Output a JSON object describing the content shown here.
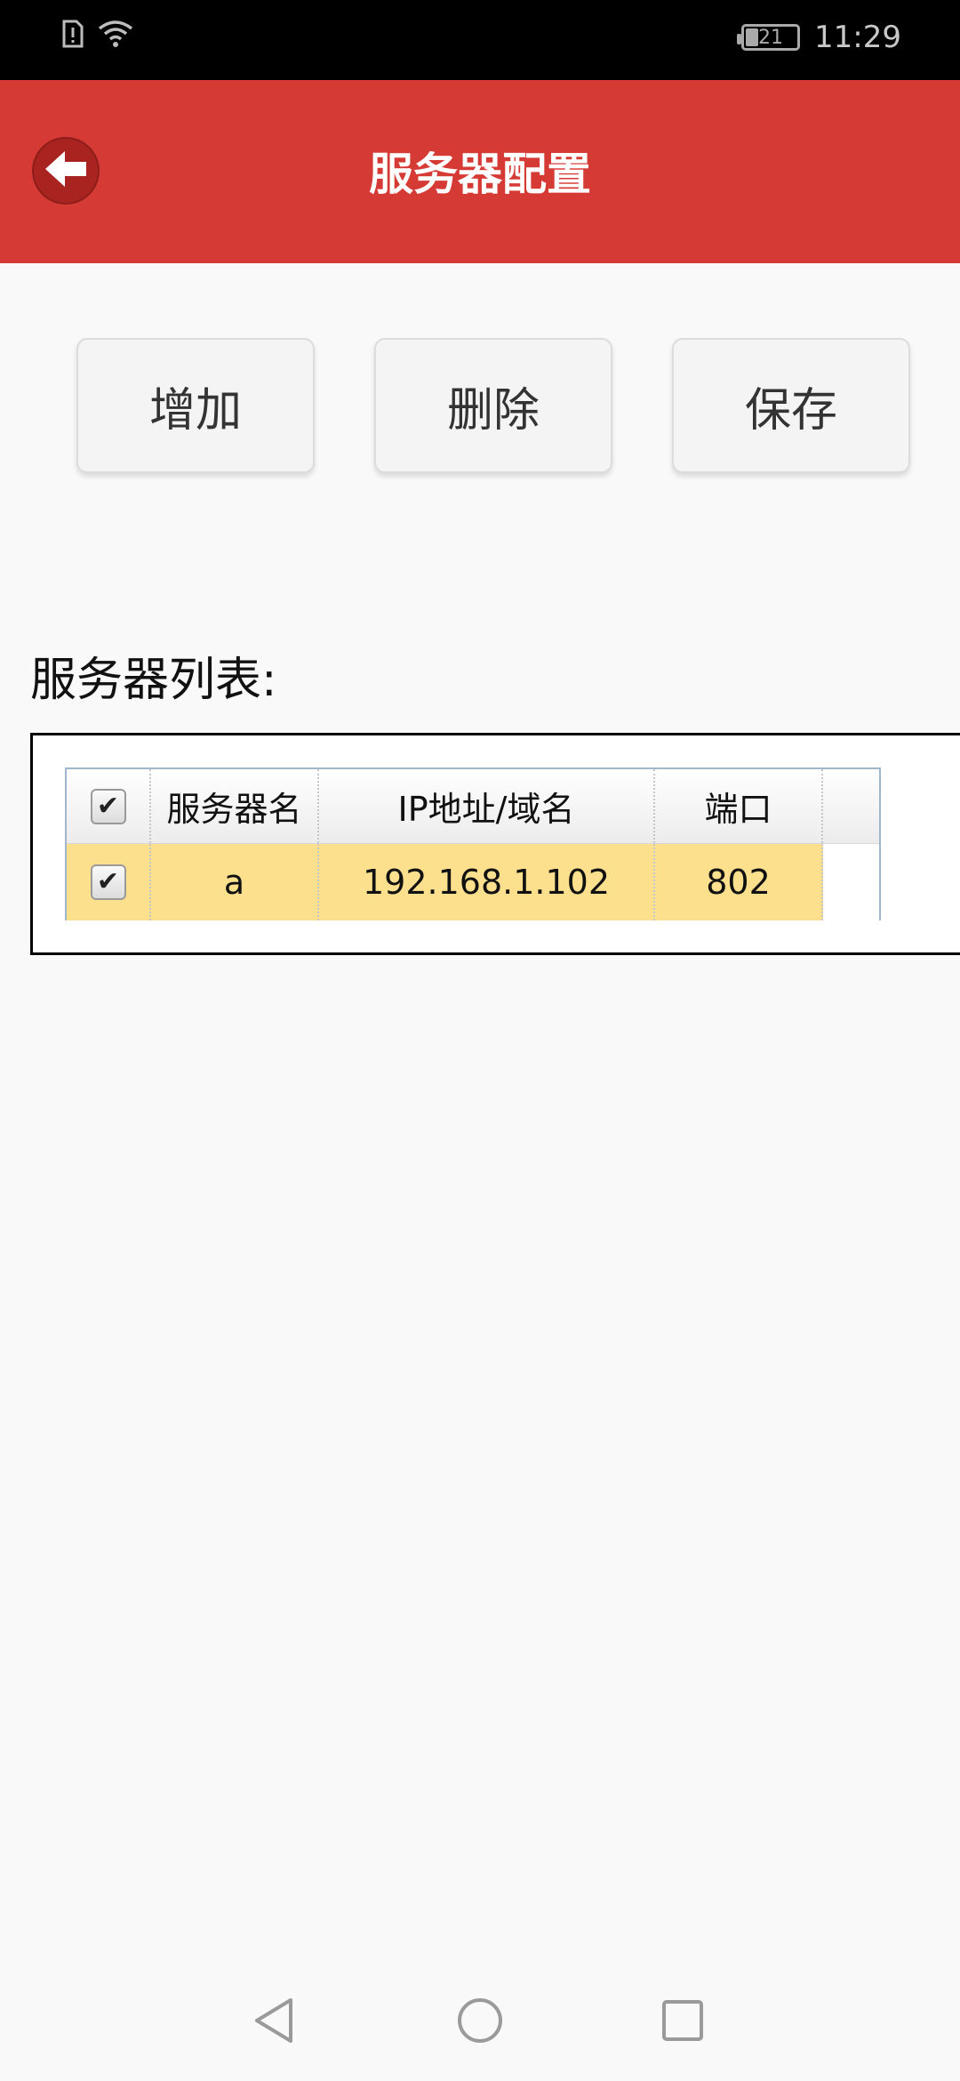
{
  "status_bar": {
    "time": "11:29",
    "battery_level": "21",
    "icons": [
      "sim-alert-icon",
      "wifi-icon",
      "battery-icon"
    ]
  },
  "app_bar": {
    "title": "服务器配置",
    "back_icon": "arrow-left-icon",
    "color": "#d63a34"
  },
  "actions": {
    "add_label": "增加",
    "delete_label": "删除",
    "save_label": "保存"
  },
  "server_list": {
    "label": "服务器列表:",
    "header_checked": true,
    "columns": [
      "服务器名",
      "IP地址/域名",
      "端口"
    ],
    "rows": [
      {
        "checked": true,
        "name": "a",
        "address": "192.168.1.102",
        "port": "802"
      }
    ],
    "selected_row_color": "#fde08e"
  },
  "nav_bar": {
    "icons": [
      "back-triangle-icon",
      "home-circle-icon",
      "recents-square-icon"
    ]
  }
}
